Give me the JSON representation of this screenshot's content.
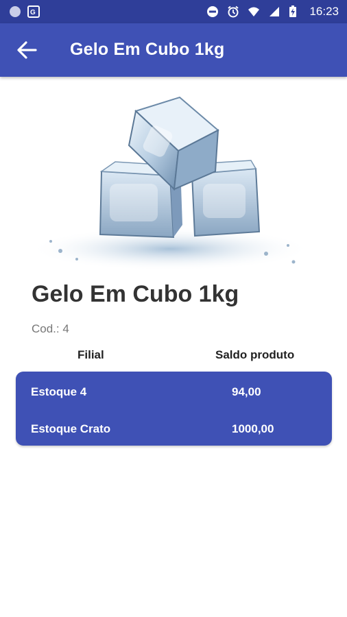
{
  "status_bar": {
    "time": "16:23",
    "icons": [
      "notification-dot-icon",
      "translate-icon",
      "do-not-disturb-icon",
      "alarm-icon",
      "wifi-icon",
      "signal-icon",
      "battery-charging-icon"
    ]
  },
  "app_bar": {
    "title": "Gelo Em Cubo 1kg",
    "back_icon": "arrow-back-icon"
  },
  "product": {
    "name": "Gelo Em Cubo 1kg",
    "code_label": "Cod.:",
    "code_value": "4",
    "image": "ice-cubes-photo"
  },
  "table": {
    "headers": [
      "Filial",
      "Saldo produto"
    ],
    "rows": [
      {
        "filial": "Estoque 4",
        "saldo": "94,00"
      },
      {
        "filial": "Estoque Crato",
        "saldo": "1000,00"
      }
    ]
  },
  "colors": {
    "status_bar": "#2f3e99",
    "primary": "#3f51b5",
    "background": "#ffffff"
  }
}
